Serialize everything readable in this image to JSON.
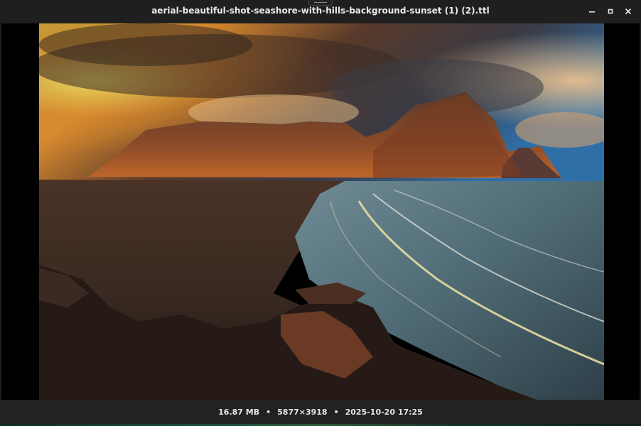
{
  "window": {
    "title": "aerial-beautiful-shot-seashore-with-hills-background-sunset (1) (2).ttl"
  },
  "controls": {
    "minimize_icon": "minimize-icon",
    "maximize_icon": "maximize-icon",
    "close_icon": "close-icon"
  },
  "image": {
    "description_icon": "photo"
  },
  "status": {
    "file_size": "16.87 MB",
    "dimensions": "5877×3918",
    "modified": "2025-10-20 17:25",
    "separator": "•"
  }
}
